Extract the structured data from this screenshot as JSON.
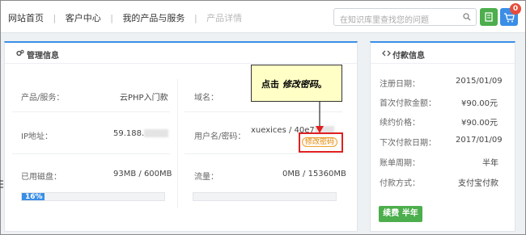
{
  "nav": {
    "breadcrumbs": [
      "网站首页",
      "客户中心",
      "我的产品与服务"
    ],
    "current": "产品详情"
  },
  "search": {
    "placeholder": "在知识库里查找您的问题"
  },
  "cart": {
    "count": "0"
  },
  "management": {
    "title": "管理信息",
    "product_label": "产品/服务：",
    "product_value": "云PHP入门款",
    "domain_label": "域名：",
    "ip_label": "IP地址：",
    "ip_value": "59.188.",
    "user_label": "用户名/密码：",
    "user_value": "xuexices / 40e7",
    "edit_password": "修改密码",
    "disk_label": "已用磁盘：",
    "disk_value": "93MB / 600MB",
    "disk_percent_text": "16%",
    "disk_percent": 16,
    "traffic_label": "流量：",
    "traffic_value": "0MB / 15360MB",
    "traffic_percent": 0
  },
  "callout": {
    "prefix": "点击 ",
    "emphasis": "修改密码",
    "suffix": "。"
  },
  "payment": {
    "title": "付款信息",
    "rows": [
      {
        "label": "注册日期：",
        "value": "2015/01/09"
      },
      {
        "label": "首次付款金额：",
        "value": "¥90.00元"
      },
      {
        "label": "续约价格：",
        "value": "¥90.00元"
      },
      {
        "label": "下次付款日期：",
        "value": "2017/01/09"
      },
      {
        "label": "账单周期：",
        "value": "半年"
      },
      {
        "label": "付款方式：",
        "value": "支付宝付款"
      }
    ],
    "renew_button": "续费 半年"
  },
  "colors": {
    "accent": "#3a8ee6",
    "green": "#4cae4c",
    "alert": "#e02020",
    "callout_bg": "#ffffc6"
  }
}
